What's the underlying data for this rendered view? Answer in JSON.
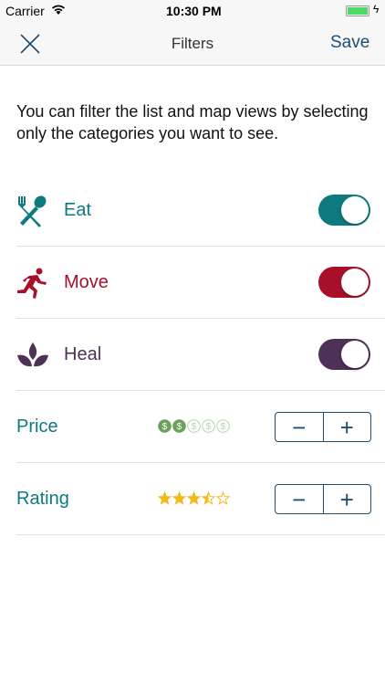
{
  "status_bar": {
    "carrier": "Carrier",
    "time": "10:30 PM",
    "battery_color": "#4cd964"
  },
  "nav": {
    "title": "Filters",
    "close_icon": "close-icon",
    "save_label": "Save",
    "accent": "#1d4e74"
  },
  "intro": "You can filter the list and map views by selecting only the categories you want to see.",
  "categories": [
    {
      "label": "Eat",
      "icon": "fork-spoon-icon",
      "color": "#0e7a80",
      "enabled": true
    },
    {
      "label": "Move",
      "icon": "runner-icon",
      "color": "#a8102a",
      "enabled": true
    },
    {
      "label": "Heal",
      "icon": "lotus-icon",
      "color": "#4d3157",
      "enabled": true
    }
  ],
  "price": {
    "label": "Price",
    "level": 2,
    "max": 5,
    "color": "#6ba25a",
    "decrement": "−",
    "increment": "+"
  },
  "rating": {
    "label": "Rating",
    "value": 3.5,
    "max": 5,
    "color": "#f5b919",
    "decrement": "−",
    "increment": "+"
  },
  "label_color": "#0e7a80"
}
